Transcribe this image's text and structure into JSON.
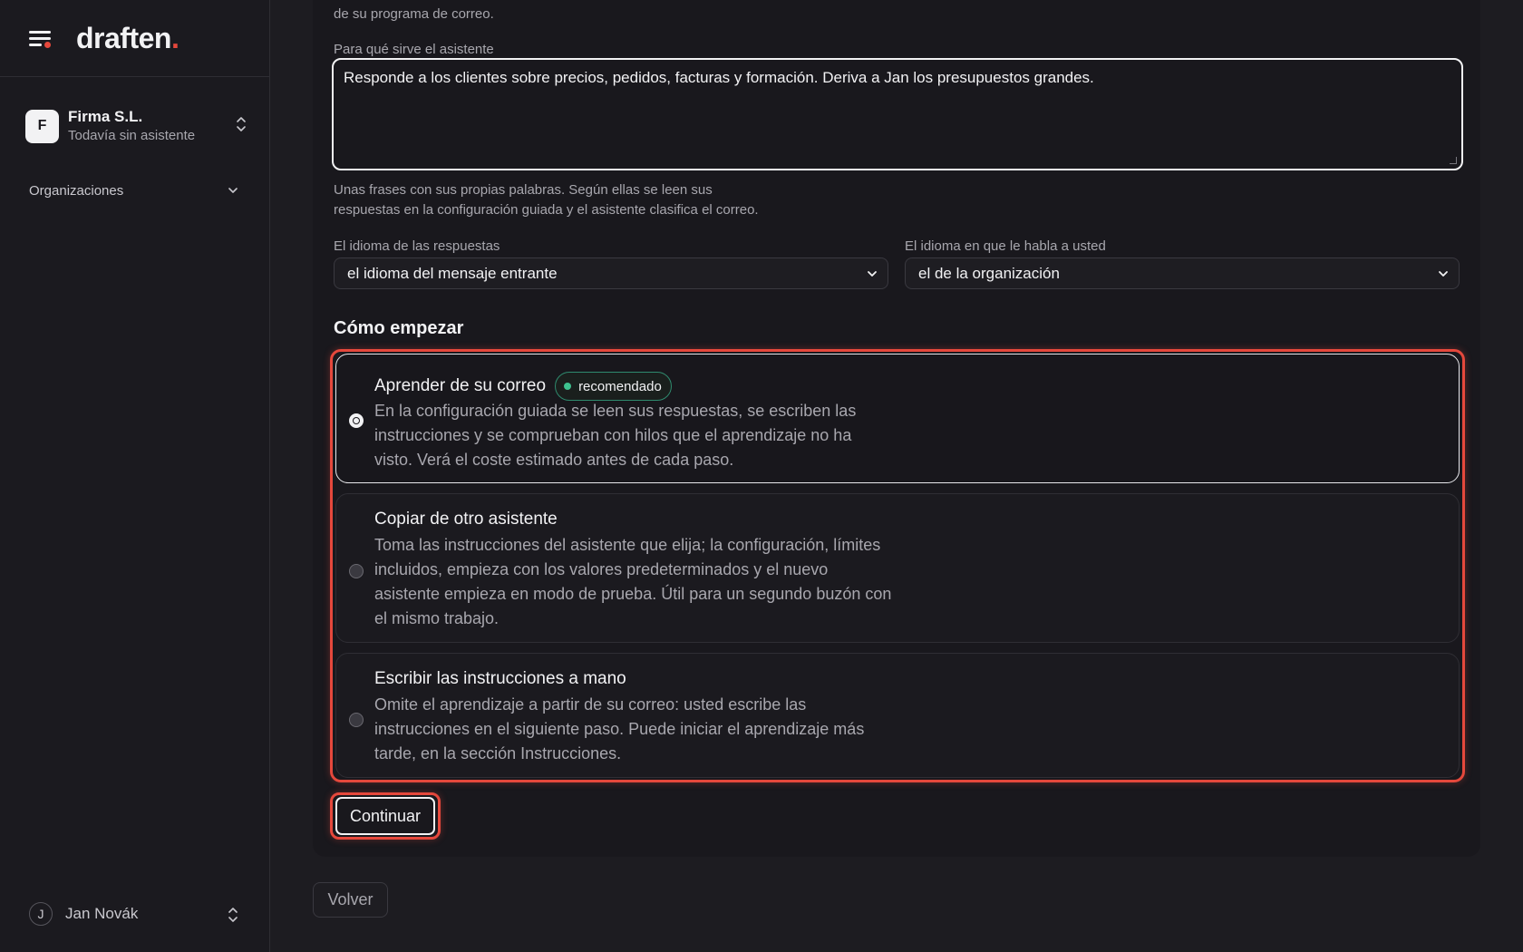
{
  "brand": {
    "name": "draften",
    "dot": "."
  },
  "org": {
    "initial": "F",
    "name": "Firma S.L.",
    "subtitle": "Todavía sin asistente"
  },
  "nav": {
    "organizations_label": "Organizaciones"
  },
  "user": {
    "initial": "J",
    "name": "Jan Novák"
  },
  "form": {
    "intro_tail": "de su programa de correo.",
    "purpose_label": "Para qué sirve el asistente",
    "purpose_value": "Responde a los clientes sobre precios, pedidos, facturas y formación. Deriva a Jan los presupuestos grandes.",
    "purpose_help_line1": "Unas frases con sus propias palabras. Según ellas se leen sus",
    "purpose_help_line2": "respuestas en la configuración guiada y el asistente clasifica el correo.",
    "reply_lang_label": "El idioma de las respuestas",
    "reply_lang_value": "el idioma del mensaje entrante",
    "speak_lang_label": "El idioma en que le habla a usted",
    "speak_lang_value": "el de la organización"
  },
  "start": {
    "title": "Cómo empezar",
    "options": [
      {
        "title": "Aprender de su correo",
        "badge": "recomendado",
        "desc_lines": [
          "En la configuración guiada se leen sus respuestas, se escriben las",
          "instrucciones y se comprueban con hilos que el aprendizaje no ha",
          "visto. Verá el coste estimado antes de cada paso."
        ],
        "selected": true
      },
      {
        "title": "Copiar de otro asistente",
        "desc_lines": [
          "Toma las instrucciones del asistente que elija; la configuración, límites",
          "incluidos, empieza con los valores predeterminados y el nuevo",
          "asistente empieza en modo de prueba. Útil para un segundo buzón con",
          "el mismo trabajo."
        ],
        "selected": false
      },
      {
        "title": "Escribir las instrucciones a mano",
        "desc_lines": [
          "Omite el aprendizaje a partir de su correo: usted escribe las",
          "instrucciones en el siguiente paso. Puede iniciar el aprendizaje más",
          "tarde, en la sección Instrucciones."
        ],
        "selected": false
      }
    ]
  },
  "actions": {
    "continue_label": "Continuar",
    "back_label": "Volver"
  },
  "colors": {
    "accent": "#e5483c",
    "badge_dot": "#3ec28f",
    "background": "#1d1c21"
  }
}
